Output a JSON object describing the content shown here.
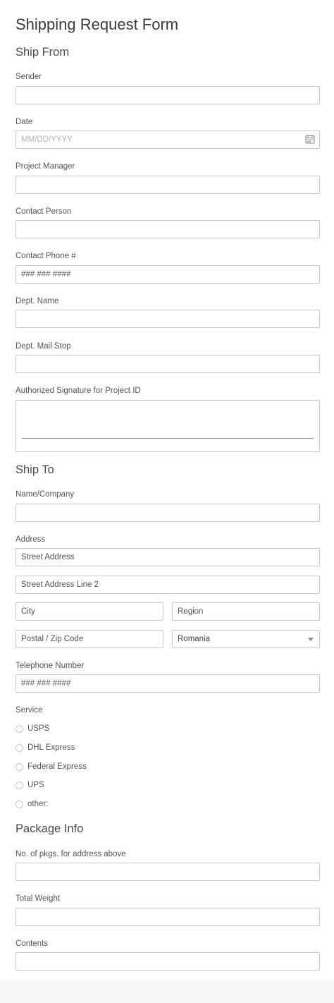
{
  "form": {
    "title": "Shipping Request Form",
    "ship_from": {
      "heading": "Ship From",
      "sender_label": "Sender",
      "date_label": "Date",
      "date_placeholder": "MM/DD/YYYY",
      "project_manager_label": "Project Manager",
      "contact_person_label": "Contact Person",
      "contact_phone_label": "Contact Phone #",
      "contact_phone_placeholder": "### ### ####",
      "dept_name_label": "Dept. Name",
      "dept_mail_stop_label": "Dept. Mail Stop",
      "signature_label": "Authorized Signature for Project ID"
    },
    "ship_to": {
      "heading": "Ship To",
      "name_company_label": "Name/Company",
      "address_label": "Address",
      "street_placeholder": "Street Address",
      "street2_placeholder": "Street Address Line 2",
      "city_placeholder": "City",
      "region_placeholder": "Region",
      "postal_placeholder": "Postal / Zip Code",
      "country_value": "Romania",
      "telephone_label": "Telephone Number",
      "telephone_placeholder": "### ### ####",
      "service_label": "Service",
      "service_options": [
        "USPS",
        "DHL Express",
        "Federal Express",
        "UPS",
        "other:"
      ]
    },
    "package_info": {
      "heading": "Package Info",
      "num_pkgs_label": "No. of pkgs. for address above",
      "total_weight_label": "Total Weight",
      "contents_label": "Contents"
    }
  }
}
